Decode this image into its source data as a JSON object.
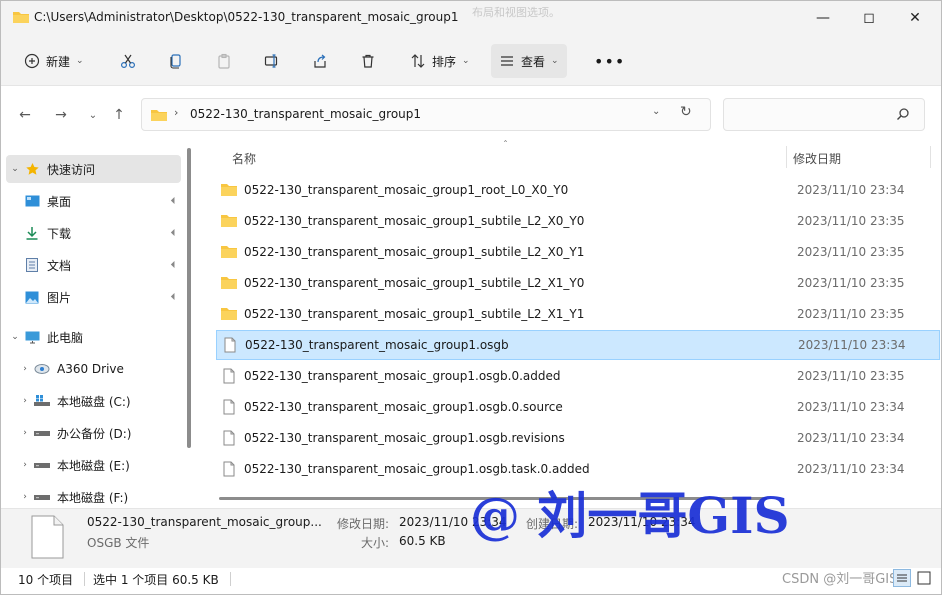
{
  "window": {
    "title": "C:\\Users\\Administrator\\Desktop\\0522-130_transparent_mosaic_group1",
    "tooltip": "布局和视图选项。"
  },
  "toolbar": {
    "new_label": "新建",
    "sort_label": "排序",
    "view_label": "查看"
  },
  "address": {
    "path": "0522-130_transparent_mosaic_group1"
  },
  "sidebar": {
    "items": [
      {
        "label": "快速访问",
        "icon": "star-icon"
      },
      {
        "label": "桌面",
        "icon": "desktop-icon"
      },
      {
        "label": "下载",
        "icon": "download-icon"
      },
      {
        "label": "文档",
        "icon": "document-icon"
      },
      {
        "label": "图片",
        "icon": "pictures-icon"
      },
      {
        "label": "此电脑",
        "icon": "computer-icon"
      },
      {
        "label": "A360 Drive",
        "icon": "cloud-drive-icon"
      },
      {
        "label": "本地磁盘 (C:)",
        "icon": "windows-drive-icon"
      },
      {
        "label": "办公备份 (D:)",
        "icon": "drive-icon"
      },
      {
        "label": "本地磁盘 (E:)",
        "icon": "drive-icon"
      },
      {
        "label": "本地磁盘 (F:)",
        "icon": "drive-icon"
      }
    ]
  },
  "filelist": {
    "columns": {
      "name": "名称",
      "date": "修改日期"
    },
    "rows": [
      {
        "name": "0522-130_transparent_mosaic_group1_root_L0_X0_Y0",
        "date": "2023/11/10 23:34",
        "type": "folder"
      },
      {
        "name": "0522-130_transparent_mosaic_group1_subtile_L2_X0_Y0",
        "date": "2023/11/10 23:35",
        "type": "folder"
      },
      {
        "name": "0522-130_transparent_mosaic_group1_subtile_L2_X0_Y1",
        "date": "2023/11/10 23:35",
        "type": "folder"
      },
      {
        "name": "0522-130_transparent_mosaic_group1_subtile_L2_X1_Y0",
        "date": "2023/11/10 23:35",
        "type": "folder"
      },
      {
        "name": "0522-130_transparent_mosaic_group1_subtile_L2_X1_Y1",
        "date": "2023/11/10 23:35",
        "type": "folder"
      },
      {
        "name": "0522-130_transparent_mosaic_group1.osgb",
        "date": "2023/11/10 23:34",
        "type": "file"
      },
      {
        "name": "0522-130_transparent_mosaic_group1.osgb.0.added",
        "date": "2023/11/10 23:35",
        "type": "file"
      },
      {
        "name": "0522-130_transparent_mosaic_group1.osgb.0.source",
        "date": "2023/11/10 23:34",
        "type": "file"
      },
      {
        "name": "0522-130_transparent_mosaic_group1.osgb.revisions",
        "date": "2023/11/10 23:34",
        "type": "file"
      },
      {
        "name": "0522-130_transparent_mosaic_group1.osgb.task.0.added",
        "date": "2023/11/10 23:34",
        "type": "file"
      }
    ]
  },
  "details": {
    "name": "0522-130_transparent_mosaic_group...",
    "type": "OSGB 文件",
    "modified_label": "修改日期:",
    "modified_value": "2023/11/10 23:34",
    "created_label": "创建日期:",
    "created_value": "2023/11/10 23:34",
    "size_label": "大小:",
    "size_value": "60.5 KB"
  },
  "status": {
    "count": "10 个项目",
    "selection": "选中 1 个项目  60.5 KB"
  },
  "watermark": {
    "text": "@ 刘一哥GIS",
    "csdn": "CSDN @刘一哥GIS"
  },
  "colors": {
    "selection_bg": "#cce8ff",
    "folder": "#f8c641",
    "watermark": "#1a2fd6"
  }
}
